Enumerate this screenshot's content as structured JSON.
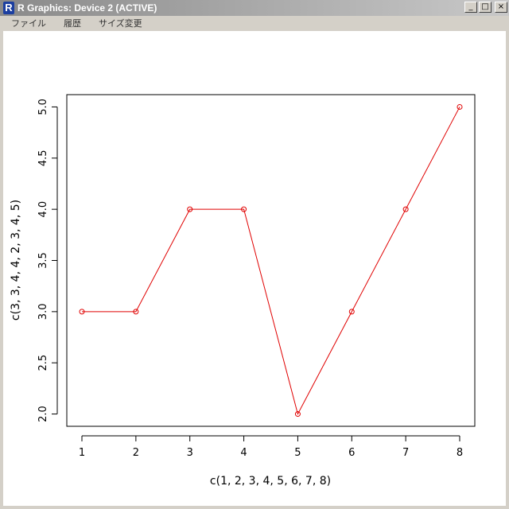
{
  "window": {
    "title": "R Graphics: Device 2 (ACTIVE)",
    "icon_letter": "R",
    "buttons": {
      "minimize": "_",
      "maximize": "□",
      "close": "×"
    }
  },
  "menu": {
    "items": [
      {
        "label": "ファイル"
      },
      {
        "label": "履歴"
      },
      {
        "label": "サイズ変更"
      }
    ]
  },
  "chart_data": {
    "type": "line",
    "title": "",
    "xlabel": "c(1, 2, 3, 4, 5, 6, 7, 8)",
    "ylabel": "c(3, 3, 4, 4, 2, 3, 4, 5)",
    "x": [
      1,
      2,
      3,
      4,
      5,
      6,
      7,
      8
    ],
    "series": [
      {
        "values": [
          3,
          3,
          4,
          4,
          2,
          3,
          4,
          5
        ],
        "color": "#e00000",
        "marker": "circle-open"
      }
    ],
    "xticks": [
      "1",
      "2",
      "3",
      "4",
      "5",
      "6",
      "7",
      "8"
    ],
    "yticks": [
      "2.0",
      "2.5",
      "3.0",
      "3.5",
      "4.0",
      "4.5",
      "5.0"
    ],
    "xlim": [
      0.72,
      8.28
    ],
    "ylim": [
      1.88,
      5.12
    ],
    "grid": false
  }
}
